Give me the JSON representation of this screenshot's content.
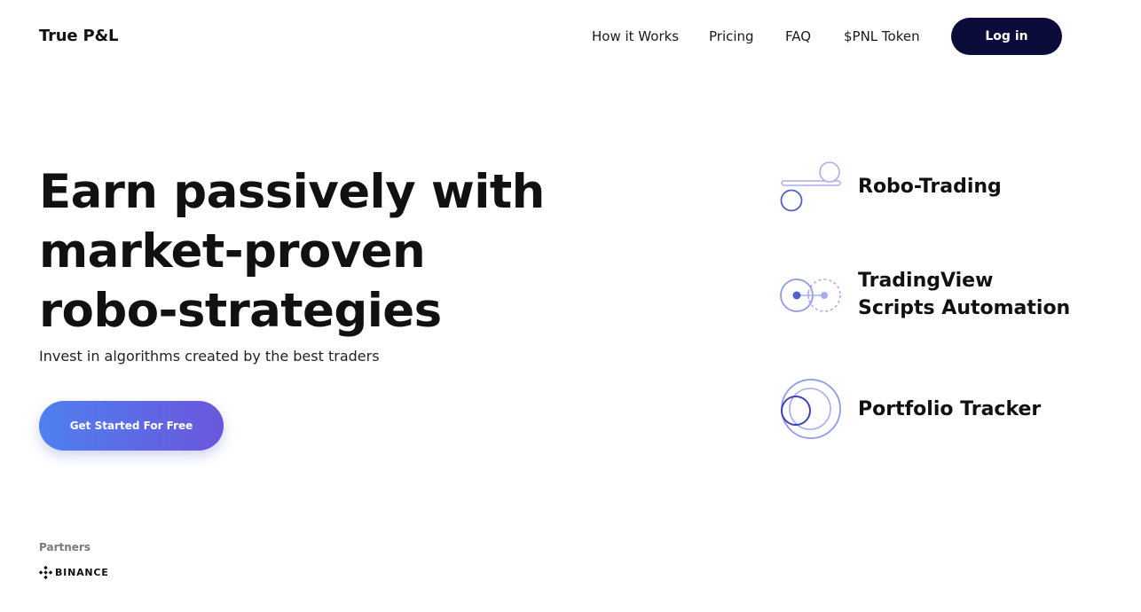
{
  "header": {
    "logo": "True P&L",
    "nav": [
      {
        "label": "How it Works"
      },
      {
        "label": "Pricing"
      },
      {
        "label": "FAQ"
      },
      {
        "label": "$PNL Token"
      }
    ],
    "login_label": "Log in"
  },
  "hero": {
    "title": "Earn passively with market-proven robo-strategies",
    "subtitle": "Invest in algorithms created by the best traders",
    "cta_label": "Get Started For Free"
  },
  "features": [
    {
      "label": "Robo-Trading",
      "icon": "robo-trading-icon"
    },
    {
      "label": "TradingView Scripts Automation",
      "icon": "tradingview-automation-icon"
    },
    {
      "label": "Portfolio Tracker",
      "icon": "portfolio-tracker-icon"
    }
  ],
  "partners": {
    "label": "Partners",
    "items": [
      {
        "name": "BINANCE",
        "icon": "binance-logo-icon"
      }
    ]
  },
  "colors": {
    "login_bg": "#0b0c3a",
    "cta_gradient_start": "#4f80ef",
    "cta_gradient_end": "#6b56dc",
    "icon_dark": "#5360d0",
    "icon_light": "#a7aef0"
  }
}
